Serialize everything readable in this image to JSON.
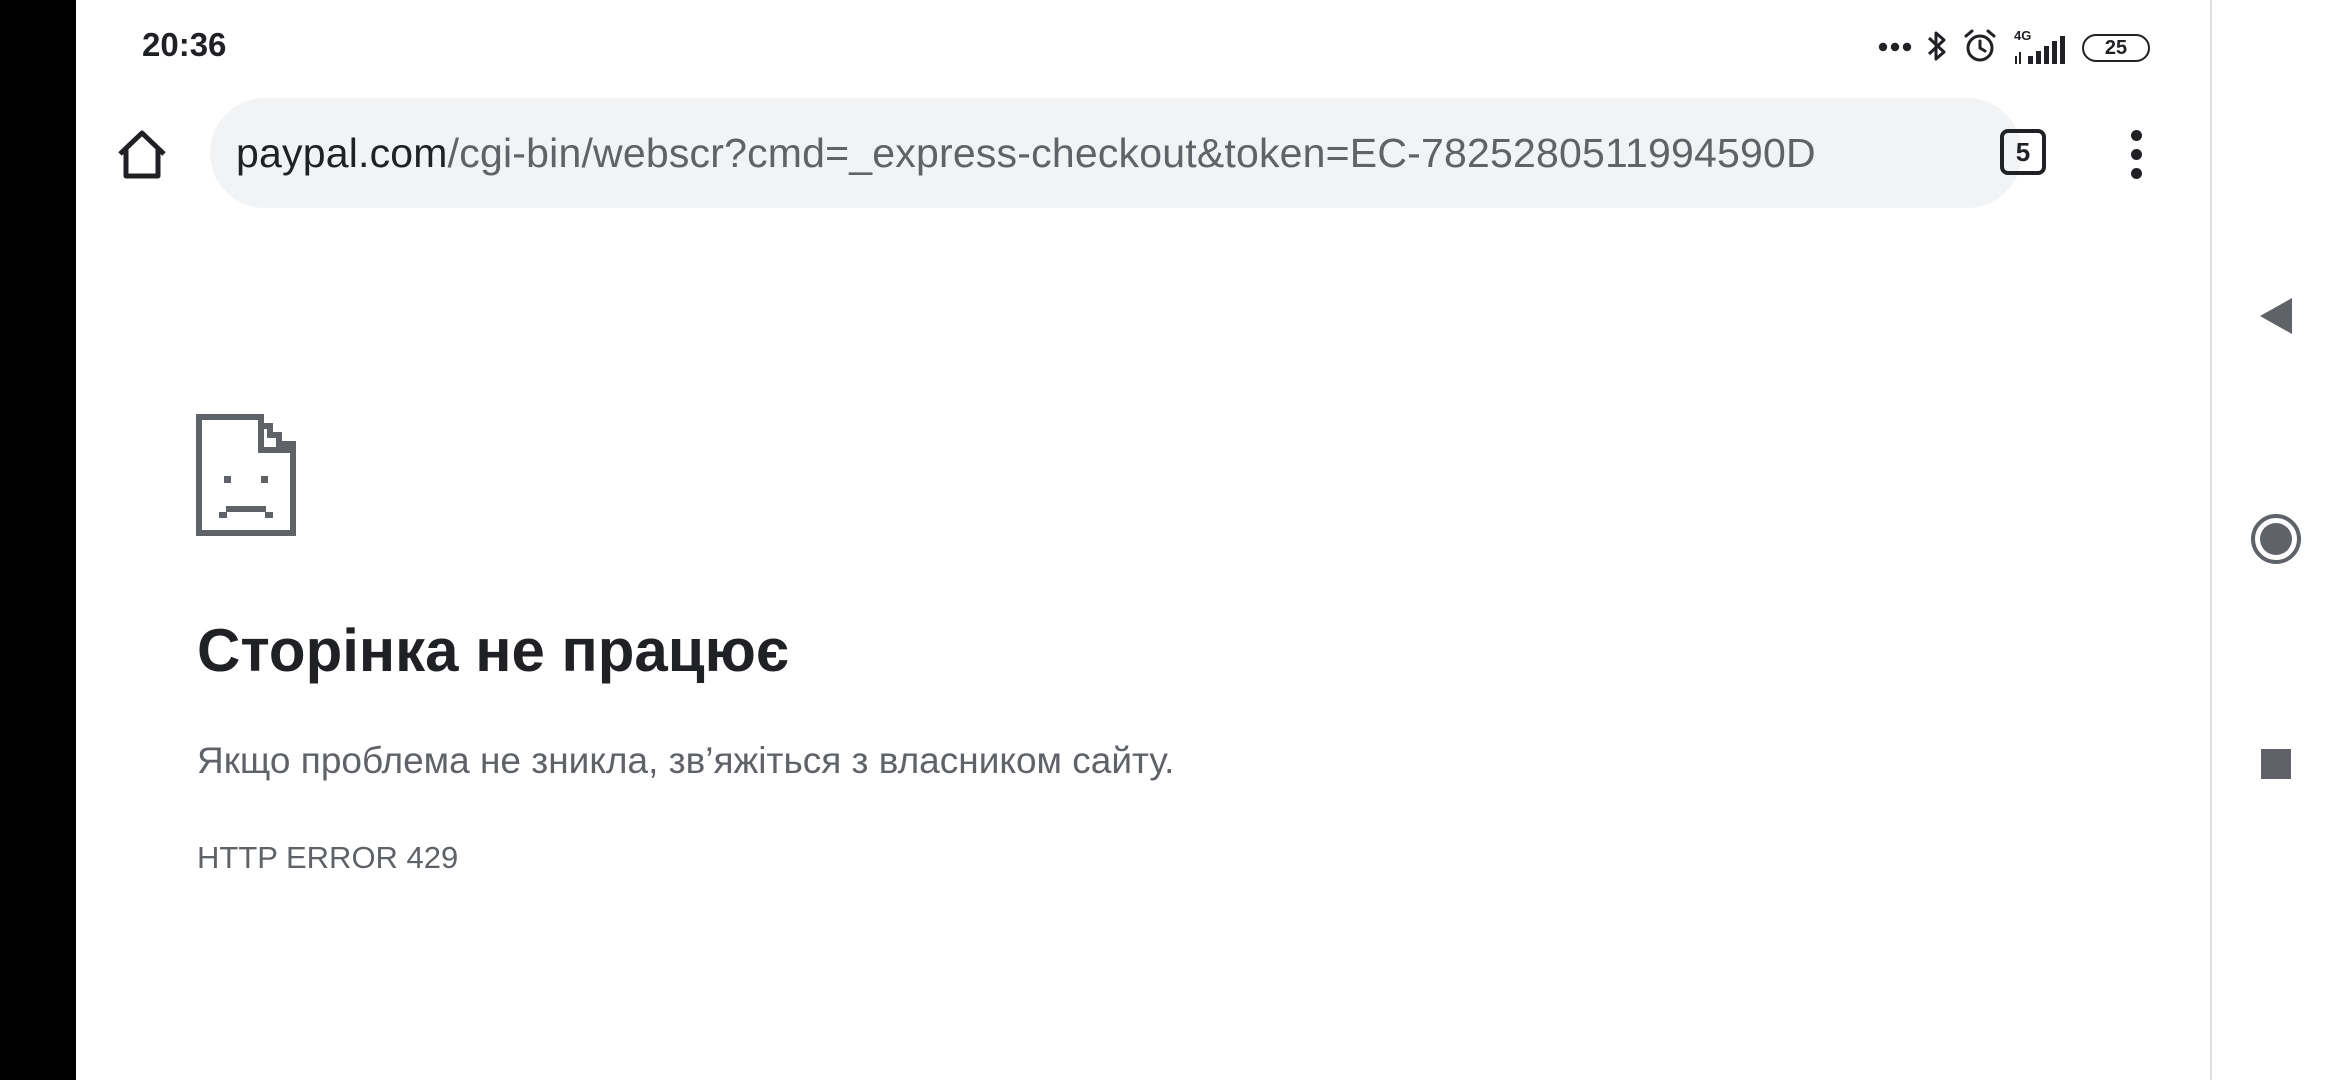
{
  "status_bar": {
    "time": "20:36",
    "network_type": "4G",
    "battery_level": "25",
    "icons": [
      "more-dots-icon",
      "bluetooth-icon",
      "alarm-icon",
      "signal-icon",
      "battery-icon"
    ]
  },
  "toolbar": {
    "url_host": "paypal.com",
    "url_path": "/cgi-bin/webscr?cmd=_express-checkout&token=EC-7825280511994590D",
    "tab_count": "5",
    "icons": [
      "home-icon",
      "tab-switcher-icon",
      "overflow-menu-icon"
    ]
  },
  "error_page": {
    "icon": "sad-page-icon",
    "title": "Сторінка не працює",
    "description": "Якщо проблема не зникла, зв’яжіться з власником сайту.",
    "error_code": "HTTP ERROR 429"
  },
  "nav_bar": {
    "icons": [
      "back-icon",
      "home-circle-icon",
      "recents-icon"
    ]
  },
  "colors": {
    "text_primary": "#202124",
    "text_secondary": "#5f6368",
    "omnibox_bg": "#f1f3f4",
    "nav_icon": "#5f6368"
  }
}
